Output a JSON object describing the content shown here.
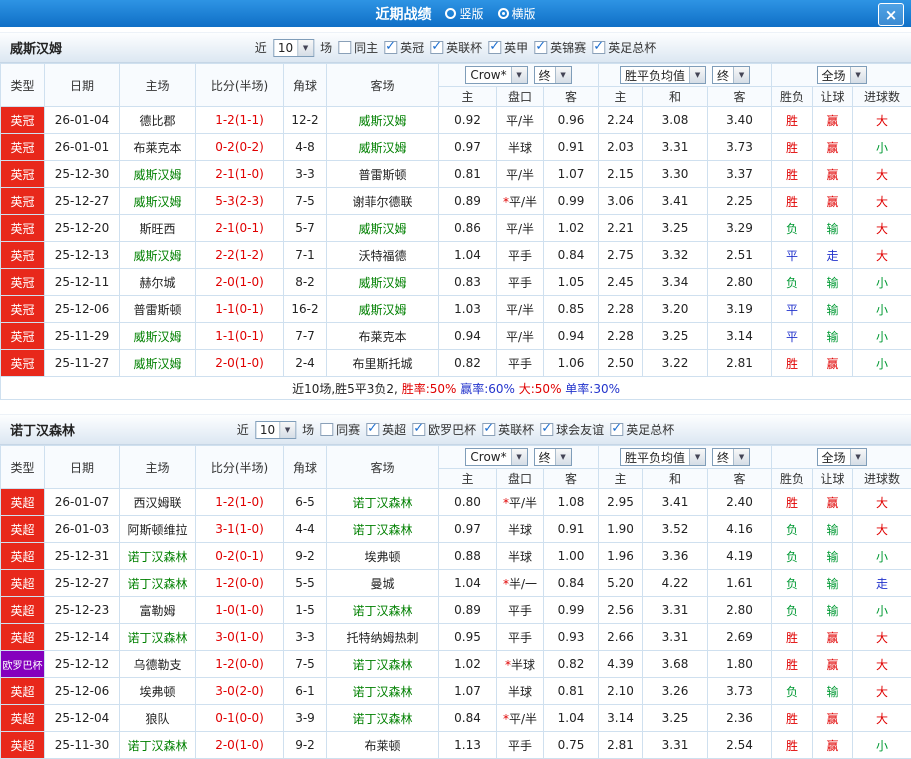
{
  "top_bar": {
    "title": "近期战绩",
    "close": "×",
    "view_options": [
      {
        "label": "竖版",
        "selected": false
      },
      {
        "label": "横版",
        "selected": true
      }
    ]
  },
  "sections": [
    {
      "team": "威斯汉姆",
      "recent": {
        "prefix": "近",
        "count": "10",
        "suffix": "场"
      },
      "filters": [
        {
          "label": "同主",
          "checked": false
        },
        {
          "label": "英冠",
          "checked": true
        },
        {
          "label": "英联杯",
          "checked": true
        },
        {
          "label": "英甲",
          "checked": true
        },
        {
          "label": "英锦赛",
          "checked": true
        },
        {
          "label": "英足总杯",
          "checked": true
        }
      ],
      "table": {
        "columns": [
          "类型",
          "日期",
          "主场",
          "比分(半场)",
          "角球",
          "客场"
        ],
        "odds_selects": [
          "Crow*",
          "终"
        ],
        "odds_cols": [
          "主",
          "盘口",
          "客"
        ],
        "avg_selects": [
          "胜平负均值",
          "终"
        ],
        "avg_cols": [
          "主",
          "和",
          "客"
        ],
        "result_select": "全场",
        "result_cols": [
          "胜负",
          "让球",
          "进球数"
        ],
        "rows": [
          {
            "league": "英冠",
            "league_color": "red",
            "date": "26-01-04",
            "home": "德比郡",
            "home_focus": false,
            "score": "1-2(1-1)",
            "corners": "12-2",
            "away": "威斯汉姆",
            "away_focus": true,
            "odds": [
              "0.92",
              "平/半",
              "0.96"
            ],
            "avg": [
              "2.24",
              "3.08",
              "3.40"
            ],
            "results": [
              [
                "胜",
                "red"
              ],
              [
                "赢",
                "red"
              ],
              [
                "大",
                "red"
              ]
            ]
          },
          {
            "league": "英冠",
            "league_color": "red",
            "date": "26-01-01",
            "home": "布莱克本",
            "home_focus": false,
            "score": "0-2(0-2)",
            "corners": "4-8",
            "away": "威斯汉姆",
            "away_focus": true,
            "odds": [
              "0.97",
              "半球",
              "0.91"
            ],
            "avg": [
              "2.03",
              "3.31",
              "3.73"
            ],
            "results": [
              [
                "胜",
                "red"
              ],
              [
                "赢",
                "red"
              ],
              [
                "小",
                "green"
              ]
            ]
          },
          {
            "league": "英冠",
            "league_color": "red",
            "date": "25-12-30",
            "home": "威斯汉姆",
            "home_focus": true,
            "score": "2-1(1-0)",
            "corners": "3-3",
            "away": "普雷斯顿",
            "away_focus": false,
            "odds": [
              "0.81",
              "平/半",
              "1.07"
            ],
            "avg": [
              "2.15",
              "3.30",
              "3.37"
            ],
            "results": [
              [
                "胜",
                "red"
              ],
              [
                "赢",
                "red"
              ],
              [
                "大",
                "red"
              ]
            ]
          },
          {
            "league": "英冠",
            "league_color": "red",
            "date": "25-12-27",
            "home": "威斯汉姆",
            "home_focus": true,
            "score": "5-3(2-3)",
            "corners": "7-5",
            "away": "谢菲尔德联",
            "away_focus": false,
            "odds": [
              "0.89",
              "*平/半",
              "0.99"
            ],
            "avg": [
              "3.06",
              "3.41",
              "2.25"
            ],
            "results": [
              [
                "胜",
                "red"
              ],
              [
                "赢",
                "red"
              ],
              [
                "大",
                "red"
              ]
            ]
          },
          {
            "league": "英冠",
            "league_color": "red",
            "date": "25-12-20",
            "home": "斯旺西",
            "home_focus": false,
            "score": "2-1(0-1)",
            "corners": "5-7",
            "away": "威斯汉姆",
            "away_focus": true,
            "odds": [
              "0.86",
              "平/半",
              "1.02"
            ],
            "avg": [
              "2.21",
              "3.25",
              "3.29"
            ],
            "results": [
              [
                "负",
                "green"
              ],
              [
                "输",
                "green"
              ],
              [
                "大",
                "red"
              ]
            ]
          },
          {
            "league": "英冠",
            "league_color": "red",
            "date": "25-12-13",
            "home": "威斯汉姆",
            "home_focus": true,
            "score": "2-2(1-2)",
            "corners": "7-1",
            "away": "沃特福德",
            "away_focus": false,
            "odds": [
              "1.04",
              "平手",
              "0.84"
            ],
            "avg": [
              "2.75",
              "3.32",
              "2.51"
            ],
            "results": [
              [
                "平",
                "blue"
              ],
              [
                "走",
                "blue"
              ],
              [
                "大",
                "red"
              ]
            ]
          },
          {
            "league": "英冠",
            "league_color": "red",
            "date": "25-12-11",
            "home": "赫尔城",
            "home_focus": false,
            "score": "2-0(1-0)",
            "corners": "8-2",
            "away": "威斯汉姆",
            "away_focus": true,
            "odds": [
              "0.83",
              "平手",
              "1.05"
            ],
            "avg": [
              "2.45",
              "3.34",
              "2.80"
            ],
            "results": [
              [
                "负",
                "green"
              ],
              [
                "输",
                "green"
              ],
              [
                "小",
                "green"
              ]
            ]
          },
          {
            "league": "英冠",
            "league_color": "red",
            "date": "25-12-06",
            "home": "普雷斯顿",
            "home_focus": false,
            "score": "1-1(0-1)",
            "corners": "16-2",
            "away": "威斯汉姆",
            "away_focus": true,
            "odds": [
              "1.03",
              "平/半",
              "0.85"
            ],
            "avg": [
              "2.28",
              "3.20",
              "3.19"
            ],
            "results": [
              [
                "平",
                "blue"
              ],
              [
                "输",
                "green"
              ],
              [
                "小",
                "green"
              ]
            ]
          },
          {
            "league": "英冠",
            "league_color": "red",
            "date": "25-11-29",
            "home": "威斯汉姆",
            "home_focus": true,
            "score": "1-1(0-1)",
            "corners": "7-7",
            "away": "布莱克本",
            "away_focus": false,
            "odds": [
              "0.94",
              "平/半",
              "0.94"
            ],
            "avg": [
              "2.28",
              "3.25",
              "3.14"
            ],
            "results": [
              [
                "平",
                "blue"
              ],
              [
                "输",
                "green"
              ],
              [
                "小",
                "green"
              ]
            ]
          },
          {
            "league": "英冠",
            "league_color": "red",
            "date": "25-11-27",
            "home": "威斯汉姆",
            "home_focus": true,
            "score": "2-0(1-0)",
            "corners": "2-4",
            "away": "布里斯托城",
            "away_focus": false,
            "odds": [
              "0.82",
              "平手",
              "1.06"
            ],
            "avg": [
              "2.50",
              "3.22",
              "2.81"
            ],
            "results": [
              [
                "胜",
                "red"
              ],
              [
                "赢",
                "red"
              ],
              [
                "小",
                "green"
              ]
            ]
          }
        ],
        "summary": [
          {
            "text": "近10场,胜5平3负2, ",
            "color": "black"
          },
          {
            "text": "胜率:50%",
            "color": "red"
          },
          {
            "text": " 赢率:60%",
            "color": "blue"
          },
          {
            "text": " 大:50%",
            "color": "red"
          },
          {
            "text": " 单率:30%",
            "color": "blue"
          }
        ]
      }
    },
    {
      "team": "诺丁汉森林",
      "recent": {
        "prefix": "近",
        "count": "10",
        "suffix": "场"
      },
      "filters": [
        {
          "label": "同赛",
          "checked": false
        },
        {
          "label": "英超",
          "checked": true
        },
        {
          "label": "欧罗巴杯",
          "checked": true
        },
        {
          "label": "英联杯",
          "checked": true
        },
        {
          "label": "球会友谊",
          "checked": true
        },
        {
          "label": "英足总杯",
          "checked": true
        }
      ],
      "table": {
        "columns": [
          "类型",
          "日期",
          "主场",
          "比分(半场)",
          "角球",
          "客场"
        ],
        "odds_selects": [
          "Crow*",
          "终"
        ],
        "odds_cols": [
          "主",
          "盘口",
          "客"
        ],
        "avg_selects": [
          "胜平负均值",
          "终"
        ],
        "avg_cols": [
          "主",
          "和",
          "客"
        ],
        "result_select": "全场",
        "result_cols": [
          "胜负",
          "让球",
          "进球数"
        ],
        "rows": [
          {
            "league": "英超",
            "league_color": "red",
            "date": "26-01-07",
            "home": "西汉姆联",
            "home_focus": false,
            "score": "1-2(1-0)",
            "corners": "6-5",
            "away": "诺丁汉森林",
            "away_focus": true,
            "odds": [
              "0.80",
              "*平/半",
              "1.08"
            ],
            "avg": [
              "2.95",
              "3.41",
              "2.40"
            ],
            "results": [
              [
                "胜",
                "red"
              ],
              [
                "赢",
                "red"
              ],
              [
                "大",
                "red"
              ]
            ]
          },
          {
            "league": "英超",
            "league_color": "red",
            "date": "26-01-03",
            "home": "阿斯顿维拉",
            "home_focus": false,
            "score": "3-1(1-0)",
            "corners": "4-4",
            "away": "诺丁汉森林",
            "away_focus": true,
            "odds": [
              "0.97",
              "半球",
              "0.91"
            ],
            "avg": [
              "1.90",
              "3.52",
              "4.16"
            ],
            "results": [
              [
                "负",
                "green"
              ],
              [
                "输",
                "green"
              ],
              [
                "大",
                "red"
              ]
            ]
          },
          {
            "league": "英超",
            "league_color": "red",
            "date": "25-12-31",
            "home": "诺丁汉森林",
            "home_focus": true,
            "score": "0-2(0-1)",
            "corners": "9-2",
            "away": "埃弗顿",
            "away_focus": false,
            "odds": [
              "0.88",
              "半球",
              "1.00"
            ],
            "avg": [
              "1.96",
              "3.36",
              "4.19"
            ],
            "results": [
              [
                "负",
                "green"
              ],
              [
                "输",
                "green"
              ],
              [
                "小",
                "green"
              ]
            ]
          },
          {
            "league": "英超",
            "league_color": "red",
            "date": "25-12-27",
            "home": "诺丁汉森林",
            "home_focus": true,
            "score": "1-2(0-0)",
            "corners": "5-5",
            "away": "曼城",
            "away_focus": false,
            "odds": [
              "1.04",
              "*半/一",
              "0.84"
            ],
            "avg": [
              "5.20",
              "4.22",
              "1.61"
            ],
            "results": [
              [
                "负",
                "green"
              ],
              [
                "输",
                "green"
              ],
              [
                "走",
                "blue"
              ]
            ]
          },
          {
            "league": "英超",
            "league_color": "red",
            "date": "25-12-23",
            "home": "富勒姆",
            "home_focus": false,
            "score": "1-0(1-0)",
            "corners": "1-5",
            "away": "诺丁汉森林",
            "away_focus": true,
            "odds": [
              "0.89",
              "平手",
              "0.99"
            ],
            "avg": [
              "2.56",
              "3.31",
              "2.80"
            ],
            "results": [
              [
                "负",
                "green"
              ],
              [
                "输",
                "green"
              ],
              [
                "小",
                "green"
              ]
            ]
          },
          {
            "league": "英超",
            "league_color": "red",
            "date": "25-12-14",
            "home": "诺丁汉森林",
            "home_focus": true,
            "score": "3-0(1-0)",
            "corners": "3-3",
            "away": "托特纳姆热刺",
            "away_focus": false,
            "odds": [
              "0.95",
              "平手",
              "0.93"
            ],
            "avg": [
              "2.66",
              "3.31",
              "2.69"
            ],
            "results": [
              [
                "胜",
                "red"
              ],
              [
                "赢",
                "red"
              ],
              [
                "大",
                "red"
              ]
            ]
          },
          {
            "league": "欧罗巴杯",
            "league_color": "purple",
            "date": "25-12-12",
            "home": "乌德勒支",
            "home_focus": false,
            "score": "1-2(0-0)",
            "corners": "7-5",
            "away": "诺丁汉森林",
            "away_focus": true,
            "odds": [
              "1.02",
              "*半球",
              "0.82"
            ],
            "avg": [
              "4.39",
              "3.68",
              "1.80"
            ],
            "results": [
              [
                "胜",
                "red"
              ],
              [
                "赢",
                "red"
              ],
              [
                "大",
                "red"
              ]
            ]
          },
          {
            "league": "英超",
            "league_color": "red",
            "date": "25-12-06",
            "home": "埃弗顿",
            "home_focus": false,
            "score": "3-0(2-0)",
            "corners": "6-1",
            "away": "诺丁汉森林",
            "away_focus": true,
            "odds": [
              "1.07",
              "半球",
              "0.81"
            ],
            "avg": [
              "2.10",
              "3.26",
              "3.73"
            ],
            "results": [
              [
                "负",
                "green"
              ],
              [
                "输",
                "green"
              ],
              [
                "大",
                "red"
              ]
            ]
          },
          {
            "league": "英超",
            "league_color": "red",
            "date": "25-12-04",
            "home": "狼队",
            "home_focus": false,
            "score": "0-1(0-0)",
            "corners": "3-9",
            "away": "诺丁汉森林",
            "away_focus": true,
            "odds": [
              "0.84",
              "*平/半",
              "1.04"
            ],
            "avg": [
              "3.14",
              "3.25",
              "2.36"
            ],
            "results": [
              [
                "胜",
                "red"
              ],
              [
                "赢",
                "red"
              ],
              [
                "大",
                "red"
              ]
            ]
          },
          {
            "league": "英超",
            "league_color": "red",
            "date": "25-11-30",
            "home": "诺丁汉森林",
            "home_focus": true,
            "score": "2-0(1-0)",
            "corners": "9-2",
            "away": "布莱顿",
            "away_focus": false,
            "odds": [
              "1.13",
              "平手",
              "0.75"
            ],
            "avg": [
              "2.81",
              "3.31",
              "2.54"
            ],
            "results": [
              [
                "胜",
                "red"
              ],
              [
                "赢",
                "red"
              ],
              [
                "小",
                "green"
              ]
            ]
          }
        ],
        "summary": null
      }
    }
  ]
}
